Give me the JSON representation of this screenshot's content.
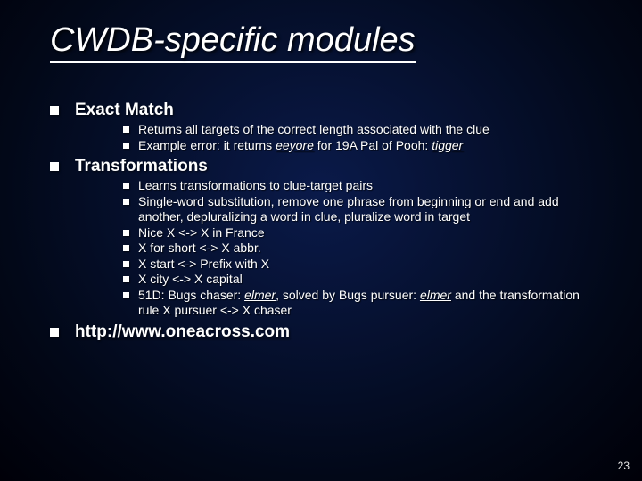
{
  "title": "CWDB-specific modules",
  "sections": [
    {
      "heading": "Exact Match",
      "link": false,
      "items": [
        {
          "text": "Returns all targets of the correct length associated with the clue"
        },
        {
          "prefix": "Example error: it returns ",
          "emph1": "eeyore",
          "mid": " for 19A Pal of Pooh: ",
          "emph2": "tigger"
        }
      ]
    },
    {
      "heading": "Transformations",
      "link": false,
      "items": [
        {
          "text": "Learns transformations to clue-target pairs"
        },
        {
          "text": "Single-word substitution, remove one phrase from beginning or end and add another, depluralizing a word in clue, pluralize word in target"
        },
        {
          "text": "Nice X <-> X in France"
        },
        {
          "text": "X for short <-> X abbr."
        },
        {
          "text": "X start <-> Prefix with X"
        },
        {
          "text": "X city <-> X capital"
        },
        {
          "prefix": "51D: Bugs chaser: ",
          "emph1": "elmer",
          "mid": ", solved by Bugs pursuer: ",
          "emph2": "elmer",
          "suffix": " and the transformation rule X pursuer <-> X chaser"
        }
      ]
    },
    {
      "heading": "http://www.oneacross.com",
      "link": true,
      "items": []
    }
  ],
  "pageNumber": "23"
}
